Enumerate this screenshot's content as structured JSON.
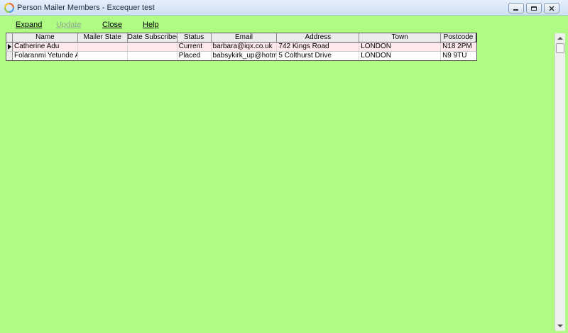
{
  "window": {
    "title": "Person Mailer Members - Excequer test",
    "icon": "app-swirl-icon"
  },
  "menu": {
    "expand": "Expand",
    "update": "Update",
    "close": "Close",
    "help": "Help"
  },
  "grid": {
    "columns": [
      "Name",
      "Mailer State",
      "Date Subscribed",
      "Status",
      "Email",
      "Address",
      "Town",
      "Postcode"
    ],
    "rows": [
      {
        "name": "Catherine Adu",
        "mailer_state": "",
        "date_subscribed": "",
        "status": "Current",
        "email": "barbara@iqx.co.uk",
        "address": "742 Kings Road",
        "town": "LONDON",
        "postcode": "N18 2PM"
      },
      {
        "name": "Folaranmi Yetunde Akin...",
        "mailer_state": "",
        "date_subscribed": "",
        "status": "Placed",
        "email": "babsykirk_up@hotmail....",
        "address": "5 Colthurst Drive",
        "town": "LONDON",
        "postcode": "N9 9TU"
      }
    ]
  },
  "colors": {
    "background": "#b0fb84",
    "selected_row": "#fde9ec"
  }
}
